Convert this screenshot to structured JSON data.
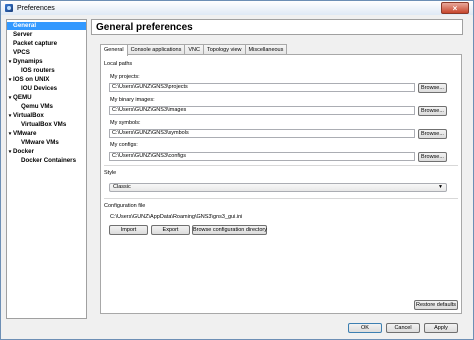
{
  "window": {
    "title": "Preferences"
  },
  "sidebar": {
    "items": [
      {
        "label": "General",
        "arrow": "",
        "selected": true
      },
      {
        "label": "Server",
        "arrow": ""
      },
      {
        "label": "Packet capture",
        "arrow": ""
      },
      {
        "label": "VPCS",
        "arrow": ""
      },
      {
        "label": "Dynamips",
        "arrow": "▾"
      },
      {
        "label": "IOS routers",
        "arrow": ""
      },
      {
        "label": "IOS on UNIX",
        "arrow": "▾"
      },
      {
        "label": "IOU Devices",
        "arrow": ""
      },
      {
        "label": "QEMU",
        "arrow": "▾"
      },
      {
        "label": "Qemu VMs",
        "arrow": ""
      },
      {
        "label": "VirtualBox",
        "arrow": "▾"
      },
      {
        "label": "VirtualBox VMs",
        "arrow": ""
      },
      {
        "label": "VMware",
        "arrow": "▾"
      },
      {
        "label": "VMware VMs",
        "arrow": ""
      },
      {
        "label": "Docker",
        "arrow": "▾"
      },
      {
        "label": "Docker Containers",
        "arrow": ""
      }
    ]
  },
  "header": {
    "title": "General preferences"
  },
  "tabs": [
    {
      "label": "General",
      "active": true
    },
    {
      "label": "Console applications"
    },
    {
      "label": "VNC"
    },
    {
      "label": "Topology view"
    },
    {
      "label": "Miscellaneous"
    }
  ],
  "local_paths": {
    "section_label": "Local paths",
    "projects": {
      "label": "My projects:",
      "value": "C:\\Users\\GUNZ\\GNS3\\projects",
      "button": "Browse..."
    },
    "binary_images": {
      "label": "My binary images:",
      "value": "C:\\Users\\GUNZ\\GNS3\\images",
      "button": "Browse..."
    },
    "symbols": {
      "label": "My symbols:",
      "value": "C:\\Users\\GUNZ\\GNS3\\symbols",
      "button": "Browse..."
    },
    "configs": {
      "label": "My configs:",
      "value": "C:\\Users\\GUNZ\\GNS3\\configs",
      "button": "Browse..."
    }
  },
  "style": {
    "section_label": "Style",
    "selected": "Classic"
  },
  "configuration_file": {
    "section_label": "Configuration file",
    "path": "C:\\Users\\GUNZ\\AppData\\Roaming\\GNS3\\gns3_gui.ini",
    "import_label": "Import",
    "export_label": "Export",
    "browse_dir_label": "Browse configuration directory"
  },
  "buttons": {
    "restore_defaults": "Restore defaults",
    "ok": "OK",
    "cancel": "Cancel",
    "apply": "Apply"
  }
}
